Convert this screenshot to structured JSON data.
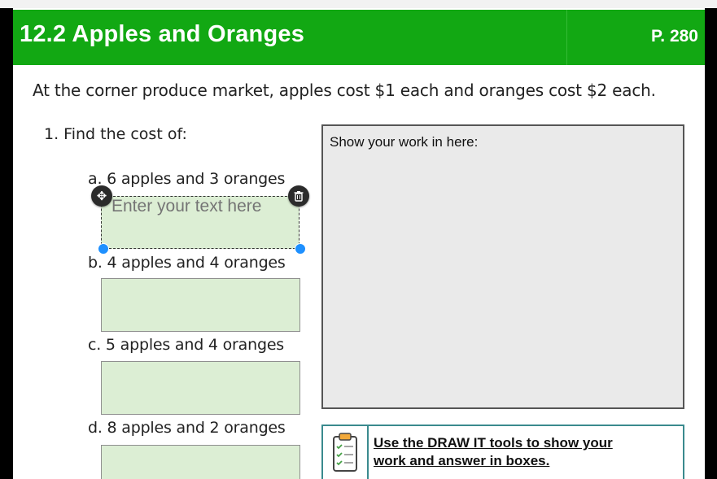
{
  "header": {
    "title": "12.2 Apples and Oranges",
    "page_number": "P. 280",
    "color": "#12a813"
  },
  "intro": "At the corner produce market, apples cost $1 each and oranges cost $2 each.",
  "question": {
    "label": "1. Find the cost of:",
    "items": [
      {
        "label": "a. 6 apples and 3 oranges",
        "placeholder": "Enter your text here"
      },
      {
        "label": "b. 4 apples and 4 oranges"
      },
      {
        "label": "c. 5 apples and 4 oranges"
      },
      {
        "label": "d. 8 apples and 2 oranges"
      }
    ]
  },
  "work_area": {
    "label": "Show your work in here:"
  },
  "instruction": {
    "line1": "Use the DRAW IT tools to show your",
    "line2": "work and answer in boxes.",
    "icon": "clipboard-checklist-icon"
  },
  "colors": {
    "answer_box_fill": "#dceed4",
    "resize_handle": "#1e90ff",
    "accent_border": "#3a8a8e"
  }
}
